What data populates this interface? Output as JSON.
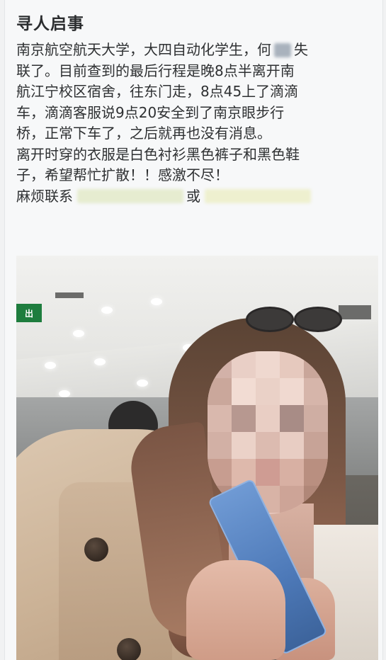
{
  "post": {
    "title": "寻人启事",
    "lines": [
      {
        "before": "南京航空航天大学，大四自动化学生，何",
        "after": "失"
      },
      {
        "text": "联了。目前查到的最后行程是晚8点半离开南"
      },
      {
        "text": "航江宁校区宿舍，往东门走，8点45上了滴滴"
      },
      {
        "text": "车，滴滴客服说9点20安全到了南京眼步行"
      },
      {
        "text": "桥，正常下车了，之后就再也没有消息。"
      },
      {
        "text": "离开时穿的衣服是白色衬衫黑色裤子和黑色鞋"
      },
      {
        "text": "子，希望帮忙扩散！！感激不尽！"
      },
      {
        "before": "麻烦联系",
        "middle": "或"
      }
    ]
  },
  "photo": {
    "exit_sign": "出",
    "colors": {
      "coat": "#cbb296",
      "hair": "#7a5745",
      "phone": "#4d79b8"
    }
  }
}
